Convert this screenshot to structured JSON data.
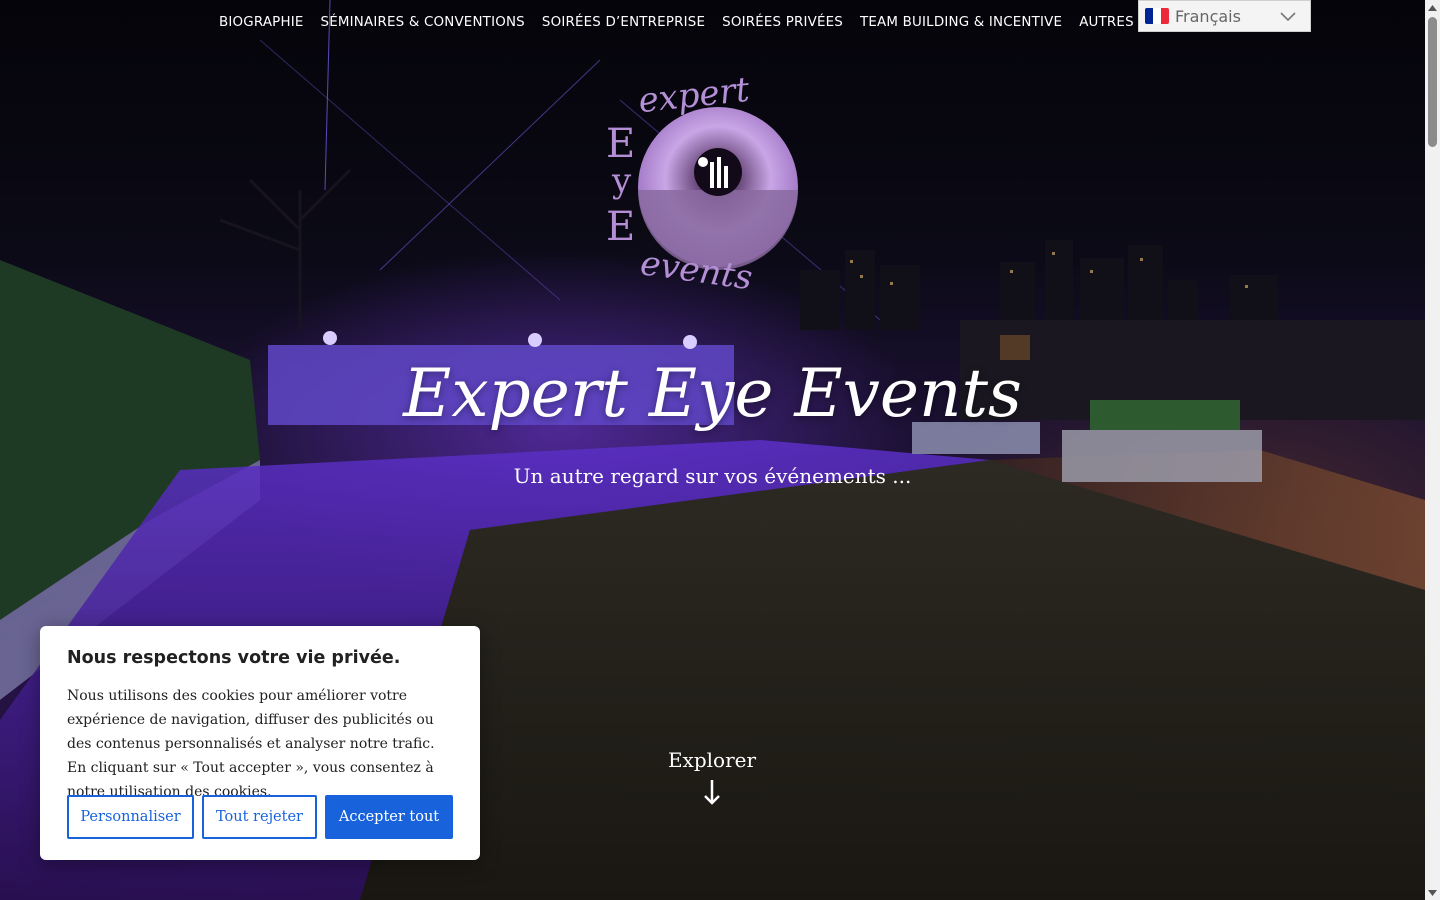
{
  "nav": {
    "items": [
      {
        "label": "BIOGRAPHIE"
      },
      {
        "label": "SÉMINAIRES & CONVENTIONS"
      },
      {
        "label": "SOIRÉES D’ENTREPRISE"
      },
      {
        "label": "SOIRÉES PRIVÉES"
      },
      {
        "label": "TEAM BUILDING & INCENTIVE"
      },
      {
        "label": "AUTRES PRE"
      }
    ]
  },
  "language": {
    "selected": "Français",
    "flag_colors": [
      "#002395",
      "#ffffff",
      "#ed2939"
    ]
  },
  "logo": {
    "text": "expert EyE events",
    "accent_color": "#b48fd6"
  },
  "hero": {
    "title": "Expert Eye Events",
    "subtitle": "Un autre regard sur vos événements ...",
    "explore_label": "Explorer"
  },
  "cookie_banner": {
    "title": "Nous respectons votre vie privée.",
    "text": "Nous utilisons des cookies pour améliorer votre expérience de navigation, diffuser des publicités ou des contenus personnalisés et analyser notre trafic. En cliquant sur « Tout accepter », vous consentez à notre utilisation des cookies.",
    "buttons": {
      "customize": "Personnaliser",
      "reject": "Tout rejeter",
      "accept": "Accepter tout"
    },
    "accent_color": "#1863dc"
  }
}
